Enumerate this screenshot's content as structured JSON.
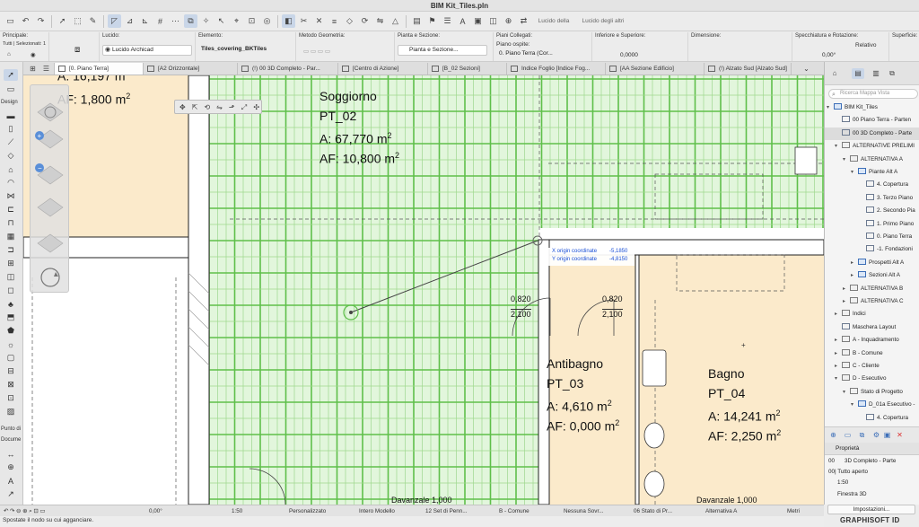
{
  "window": {
    "title": "BIM Kit_Tiles.pln"
  },
  "toolbar": {
    "tracing_label_1": "Lucido della",
    "tracing_label_2": "Lucido degli altri"
  },
  "infobox": {
    "principale": {
      "label": "Principale:",
      "sublabel": "Tutti | Selezionati: 1"
    },
    "lucido": {
      "label": "Lucido:",
      "value": "Lucido Archicad"
    },
    "elemento": {
      "label": "Elemento:",
      "value": "Tiles_covering_BKTiles"
    },
    "metodo": {
      "label": "Metodo Geometria:"
    },
    "pianta": {
      "label": "Pianta e Sezione:",
      "value": "Pianta e Sezione..."
    },
    "piani": {
      "label": "Piani Collegati:",
      "sublabel": "Piano ospite:",
      "value": "0. Piano Terra (Cor..."
    },
    "inferiore": {
      "label": "Inferiore e Superiore:",
      "value": "0,0000"
    },
    "dimensione": {
      "label": "Dimensione:"
    },
    "specchiatura": {
      "label": "Specchiatura e Rotazione:",
      "relative": "Relativo",
      "angle": "0,00°"
    },
    "superficie": {
      "label": "Superficie:"
    }
  },
  "tabs": [
    {
      "label": "[0. Piano Terra]",
      "active": true
    },
    {
      "label": "[A2 Orizzontale]"
    },
    {
      "label": "(!) 00 3D Completo - Par..."
    },
    {
      "label": "[Centro di Azione]"
    },
    {
      "label": "[B_02 Sezioni]"
    },
    {
      "label": "Indice Foglio [Indice Fog..."
    },
    {
      "label": "[AA Sezione Edificio]"
    },
    {
      "label": "(!) Alzato Sud [Alzato Sud]"
    }
  ],
  "toolbox": {
    "design_label": "Design",
    "documento_label_1": "Punto di",
    "documento_label_2": "Docume"
  },
  "rooms": [
    {
      "name": "Soggiorno",
      "id": "PT_02",
      "area": "A:   67,770 m",
      "floor_area": "AF: 10,800 m"
    },
    {
      "name": "Antibagno",
      "id": "PT_03",
      "area": "A:  4,610 m",
      "floor_area": "AF: 0,000 m"
    },
    {
      "name": "Bagno",
      "id": "PT_04",
      "area": "A: 14,241 m",
      "floor_area": "AF: 2,250 m"
    }
  ],
  "partial_room": {
    "area": "A: 16,197 m",
    "floor_area": "AF: 1,800 m"
  },
  "area_unit_sup": "2",
  "openings": [
    {
      "width": "0,820",
      "height": "2,100"
    },
    {
      "width": "0,820",
      "height": "2,100"
    }
  ],
  "sill_labels": [
    "Davanzale 1,000",
    "Davanzale 1,000"
  ],
  "tracker": {
    "x_label": "X origin coordinate",
    "x_value": "-5,1850",
    "y_label": "Y origin coordinate",
    "y_value": "-4,8150"
  },
  "navigator": {
    "search_placeholder": "Ricerca Mappa Vista",
    "tree": [
      {
        "label": "BIM Kit_Tiles",
        "depth": 0,
        "arrow": "▾",
        "icon": "blue"
      },
      {
        "label": "00 Piano Terra - Parten",
        "depth": 1,
        "arrow": "",
        "icon": "plain"
      },
      {
        "label": "00 3D Completo - Parte",
        "depth": 1,
        "arrow": "",
        "icon": "plain",
        "selected": true
      },
      {
        "label": "ALTERNATIVE PRELIMI",
        "depth": 1,
        "arrow": "▾",
        "icon": "folder"
      },
      {
        "label": "ALTERNATIVA A",
        "depth": 2,
        "arrow": "▾",
        "icon": "folder"
      },
      {
        "label": "Piante Alt A",
        "depth": 3,
        "arrow": "▾",
        "icon": "blue"
      },
      {
        "label": "4. Copertura",
        "depth": 4,
        "arrow": "",
        "icon": "plain"
      },
      {
        "label": "3. Terzo Piano",
        "depth": 4,
        "arrow": "",
        "icon": "plain"
      },
      {
        "label": "2. Secondo Pia",
        "depth": 4,
        "arrow": "",
        "icon": "plain"
      },
      {
        "label": "1. Primo Piano",
        "depth": 4,
        "arrow": "",
        "icon": "plain"
      },
      {
        "label": "0. Piano Terra",
        "depth": 4,
        "arrow": "",
        "icon": "plain"
      },
      {
        "label": "-1. Fondazioni",
        "depth": 4,
        "arrow": "",
        "icon": "plain"
      },
      {
        "label": "Prospetti Alt A",
        "depth": 3,
        "arrow": "▸",
        "icon": "blue"
      },
      {
        "label": "Sezioni Alt A",
        "depth": 3,
        "arrow": "▸",
        "icon": "blue"
      },
      {
        "label": "ALTERNATIVA B",
        "depth": 2,
        "arrow": "▸",
        "icon": "folder"
      },
      {
        "label": "ALTERNATIVA C",
        "depth": 2,
        "arrow": "▸",
        "icon": "folder"
      },
      {
        "label": "Indici",
        "depth": 1,
        "arrow": "▸",
        "icon": "folder"
      },
      {
        "label": "Maschera Layout",
        "depth": 1,
        "arrow": "",
        "icon": "plain"
      },
      {
        "label": "A - Inquadramento",
        "depth": 1,
        "arrow": "▸",
        "icon": "folder"
      },
      {
        "label": "B - Comune",
        "depth": 1,
        "arrow": "▸",
        "icon": "folder"
      },
      {
        "label": "C - Cliente",
        "depth": 1,
        "arrow": "▸",
        "icon": "folder"
      },
      {
        "label": "D - Esecutivo",
        "depth": 1,
        "arrow": "▾",
        "icon": "folder"
      },
      {
        "label": "Stato di Progetto",
        "depth": 2,
        "arrow": "▾",
        "icon": "folder"
      },
      {
        "label": "D_01a Esecutivo -",
        "depth": 3,
        "arrow": "▾",
        "icon": "blue"
      },
      {
        "label": "4. Copertura",
        "depth": 4,
        "arrow": "",
        "icon": "plain"
      }
    ],
    "properties_header": "Proprietà",
    "prop_id": "00",
    "prop_name": "3D Completo - Parte",
    "prop_layer": "00| Tutto aperto",
    "prop_scale": "1:50",
    "prop_window": "Finestra 3D",
    "settings_button": "Impostazioni..."
  },
  "statusbar": {
    "angle": "0,00°",
    "scale": "1:50",
    "custom": "Personalizzato",
    "model": "Intero Modello",
    "pen_set": "12 Set di Penn...",
    "layer_combo": "B - Comune",
    "overrides": "Nessuna Sovr...",
    "renovation": "06 Stato di Pr...",
    "alternative": "Alternativa A",
    "units": "Metri"
  },
  "hint": "Spostate il nodo su cui agganciare.",
  "brand": "GRAPHISOFT ID",
  "colors": {
    "tile_fill": "#e2f6dc",
    "tile_line_dark": "#5fbf4a",
    "tile_line_light": "#9fd88e",
    "room_fill": "#fbeacb",
    "tracker_text": "#1a4fd6",
    "selection": "#c9d6e8"
  }
}
